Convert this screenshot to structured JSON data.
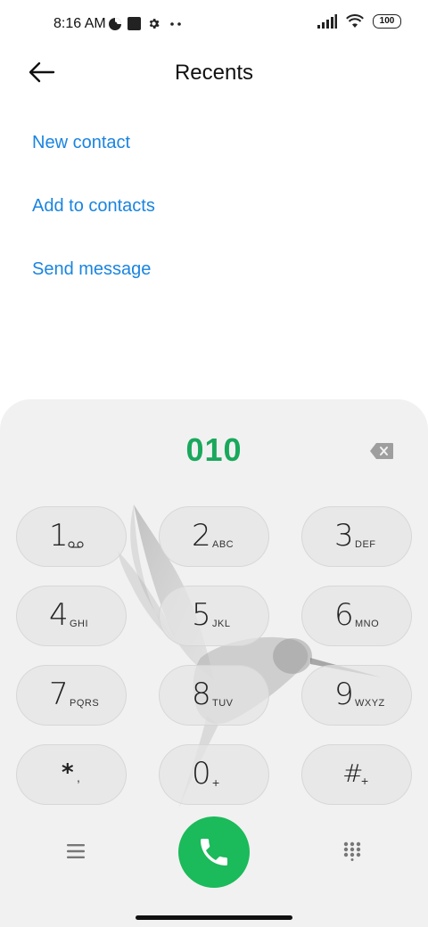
{
  "status_bar": {
    "time": "8:16 AM",
    "icons_left": [
      "data-saver-icon",
      "square-notification-icon",
      "gear-icon",
      "more-dots-icon"
    ],
    "icons_right": [
      "signal-icon",
      "wifi-icon",
      "battery-icon"
    ],
    "battery_level": "100"
  },
  "header": {
    "title": "Recents",
    "back_icon": "back-arrow-icon"
  },
  "actions": [
    {
      "label": "New contact"
    },
    {
      "label": "Add to contacts"
    },
    {
      "label": "Send message"
    }
  ],
  "dialer": {
    "entered_number": "010",
    "backspace_icon": "backspace-icon",
    "keys": [
      {
        "digit": "1",
        "letters": ""
      },
      {
        "digit": "2",
        "letters": "ABC"
      },
      {
        "digit": "3",
        "letters": "DEF"
      },
      {
        "digit": "4",
        "letters": "GHI"
      },
      {
        "digit": "5",
        "letters": "JKL"
      },
      {
        "digit": "6",
        "letters": "MNO"
      },
      {
        "digit": "7",
        "letters": "PQRS"
      },
      {
        "digit": "8",
        "letters": "TUV"
      },
      {
        "digit": "9",
        "letters": "WXYZ"
      },
      {
        "digit": "*",
        "letters": ","
      },
      {
        "digit": "0",
        "letters": "+"
      },
      {
        "digit": "#",
        "letters": "+"
      }
    ],
    "bottom": {
      "menu_icon": "menu-icon",
      "call_icon": "phone-icon",
      "keypad_icon": "dialpad-icon"
    }
  },
  "colors": {
    "link": "#1a84e0",
    "number": "#1aa85c",
    "call_button": "#1bba5a",
    "panel": "#f1f1f1"
  }
}
